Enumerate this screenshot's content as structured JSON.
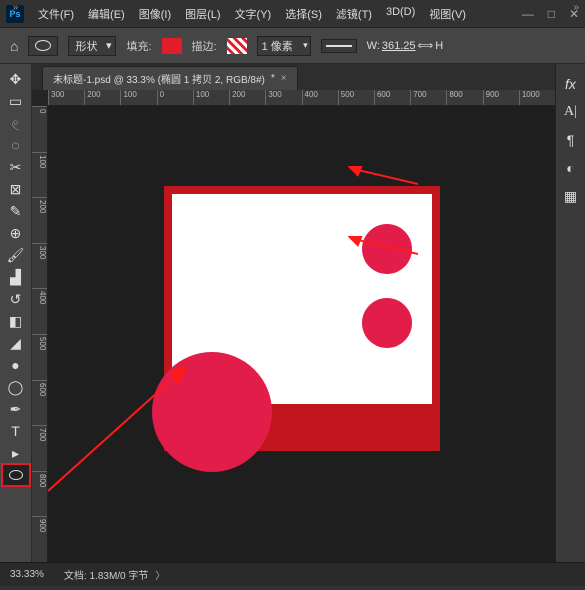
{
  "app": {
    "logo": "Ps"
  },
  "menu": {
    "file": "文件(F)",
    "edit": "编辑(E)",
    "image": "图像(I)",
    "layer": "图层(L)",
    "type": "文字(Y)",
    "select": "选择(S)",
    "filter": "滤镜(T)",
    "3d": "3D(D)",
    "view": "视图(V)"
  },
  "opt": {
    "shape_mode": "形状",
    "fill_label": "填充:",
    "stroke_label": "描边:",
    "stroke_w": "1 像素",
    "w_label": "W:",
    "w_val": "361.25",
    "link": "⟺",
    "h_label": "H"
  },
  "tab": {
    "title": "未标题-1.psd @ 33.3% (椭圆 1 拷贝 2, RGB/8#)"
  },
  "ruler_h": [
    "300",
    "200",
    "100",
    "0",
    "100",
    "200",
    "300",
    "400",
    "500",
    "600",
    "700",
    "800",
    "900",
    "1000"
  ],
  "ruler_v": [
    "0",
    "100",
    "200",
    "300",
    "400",
    "500",
    "600",
    "700",
    "800",
    "900"
  ],
  "status": {
    "zoom": "33.33%",
    "doc_label": "文档:",
    "doc_info": "1.83M/0 字节"
  }
}
